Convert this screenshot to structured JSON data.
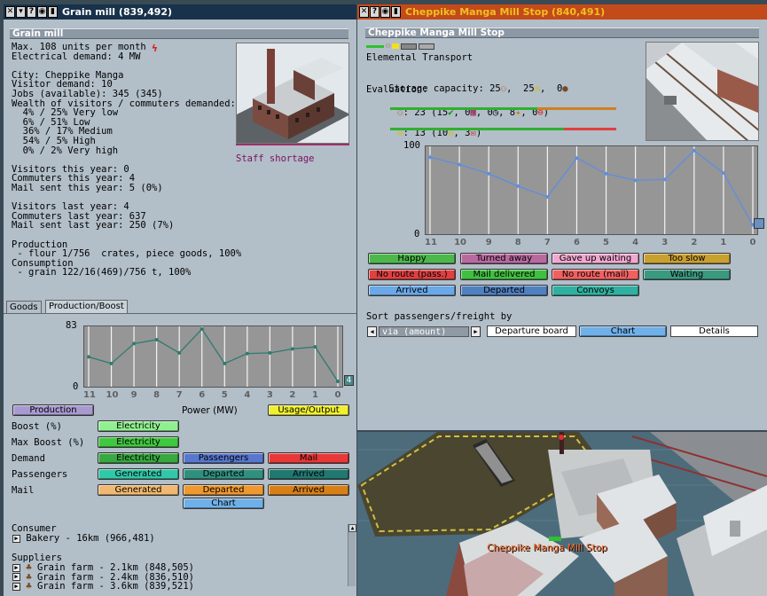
{
  "left": {
    "title": "Grain mill (839,492)",
    "section": "Grain mill",
    "info": [
      "Max. 108 units per month",
      "Electrical demand: 4 MW",
      "",
      "City: Cheppike Manga",
      "Visitor demand: 10",
      "Jobs (available): 345 (345)",
      "Wealth of visitors / commuters demanded:",
      "  4% / 25% Very low",
      "  6% / 51% Low",
      "  36% / 17% Medium",
      "  54% / 5% High",
      "  0% / 2% Very high",
      "",
      "Visitors this year: 0",
      "Commuters this year: 4",
      "Mail sent this year: 5 (0%)",
      "",
      "Visitors last year: 4",
      "Commuters last year: 637",
      "Mail sent last year: 250 (7%)",
      "",
      "Production",
      " - flour 1/756  crates, piece goods, 100%",
      "Consumption",
      " - grain 122/16(469)/756 t, 100%"
    ],
    "staff_shortage": "Staff shortage",
    "tabs": [
      "Goods",
      "Production/Boost"
    ],
    "chart_data": {
      "type": "line",
      "categories": [
        "11",
        "10",
        "9",
        "8",
        "7",
        "6",
        "5",
        "4",
        "3",
        "2",
        "1",
        "0"
      ],
      "values": [
        41,
        31,
        61,
        67,
        47,
        83,
        31,
        46,
        47,
        53,
        56,
        4
      ],
      "ylim": [
        0,
        83
      ],
      "yticks": [
        "83",
        "0"
      ],
      "end_badge": "4",
      "color": "#2e7a70"
    },
    "power_label": "Power (MW)",
    "buttons": {
      "production": "Production",
      "usage_output": "Usage/Output",
      "boost": {
        "label": "Boost (%)",
        "electricity": "Electricity"
      },
      "max_boost": {
        "label": "Max Boost (%)",
        "electricity": "Electricity"
      },
      "demand": {
        "label": "Demand",
        "electricity": "Electricity",
        "passengers": "Passengers",
        "mail": "Mail"
      },
      "passengers": {
        "label": "Passengers",
        "generated": "Generated",
        "departed": "Departed",
        "arrived": "Arrived"
      },
      "mail": {
        "label": "Mail",
        "generated": "Generated",
        "departed": "Departed",
        "arrived": "Arrived"
      },
      "chart": "Chart"
    },
    "consumer": {
      "label": "Consumer",
      "items": [
        "Bakery - 16km (966,481)"
      ]
    },
    "suppliers": {
      "label": "Suppliers",
      "items": [
        "Grain farm - 2.1km (848,505)",
        "Grain farm - 2.4km (836,510)",
        "Grain farm - 3.6km (839,521)"
      ]
    }
  },
  "right": {
    "title": "Cheppike Manga Mill Stop (840,491)",
    "section": "Cheppike Manga Mill Stop",
    "company": "Elemental Transport",
    "storage_label": "Storage capacity: 25",
    "storage_mid": ",  25",
    "storage_end": ",  0",
    "evaluation_label": "Evaluation:",
    "eval_pass": {
      "a": ": 23 (15",
      "b": ", 0",
      "c": ", 0",
      "d": ", 8",
      "e": ", 0",
      "f": ")"
    },
    "eval_mail": {
      "a": ": 13 (10",
      "b": ", 3",
      "c": ")"
    },
    "chart_data": {
      "type": "line",
      "categories": [
        "11",
        "10",
        "9",
        "8",
        "7",
        "6",
        "5",
        "4",
        "3",
        "2",
        "1",
        "0"
      ],
      "values": [
        90,
        81,
        70,
        55,
        42,
        89,
        70,
        62,
        63,
        98,
        71,
        8
      ],
      "ylim": [
        0,
        100
      ],
      "yticks": [
        "100",
        "0"
      ],
      "color": "#5d8ee0"
    },
    "legend": [
      {
        "label": "Happy",
        "color": "#4cb84c"
      },
      {
        "label": "Turned away",
        "color": "#b86aa0"
      },
      {
        "label": "Gave up waiting",
        "color": "#f0a8d0"
      },
      {
        "label": "Too slow",
        "color": "#c8a030"
      },
      {
        "label": "No route (pass.)",
        "color": "#e04040"
      },
      {
        "label": "Mail delivered",
        "color": "#40c040"
      },
      {
        "label": "No route (mail)",
        "color": "#f06060"
      },
      {
        "label": "Waiting",
        "color": "#3a9a80"
      },
      {
        "label": "Arrived",
        "color": "#6aa8e8"
      },
      {
        "label": "Departed",
        "color": "#5080c0"
      },
      {
        "label": "Convoys",
        "color": "#30b0a0"
      }
    ],
    "sort_label": "Sort passengers/freight by",
    "sort_value": "via (amount)",
    "departure_board": "Departure board",
    "chart_button": "Chart",
    "details_button": "Details",
    "map_label": "Cheppike Manga Mill Stop"
  },
  "colors": {
    "left_title": "#17324a",
    "right_title": "#c44a1a",
    "station_label": "#ff6a2a"
  }
}
